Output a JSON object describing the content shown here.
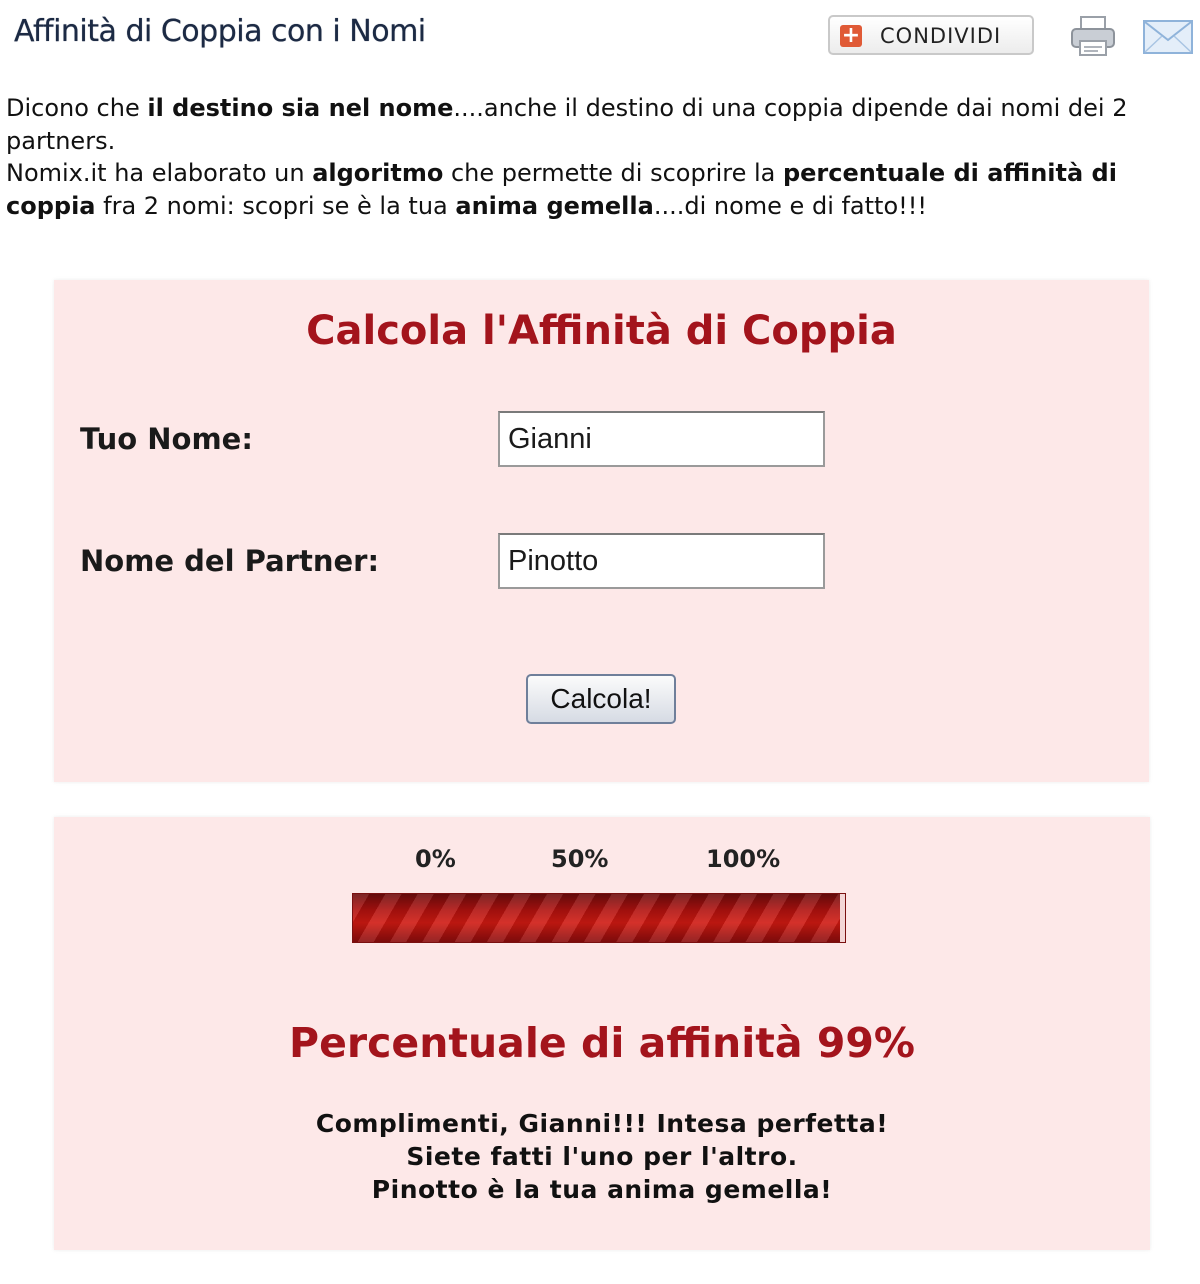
{
  "header": {
    "title": "Affinità di Coppia con i Nomi",
    "share_label": "CONDIVIDI",
    "share_icon": "plus-icon",
    "print_icon": "printer-icon",
    "mail_icon": "envelope-icon"
  },
  "intro": {
    "p1_a": "Dicono che ",
    "p1_b": "il destino sia nel nome",
    "p1_c": "....anche il destino di una coppia dipende dai nomi dei 2 partners.",
    "p2_a": "Nomix.it ha elaborato un ",
    "p2_b": "algoritmo",
    "p2_c": " che permette di scoprire la ",
    "p2_d": "percentuale di affinità di coppia",
    "p2_e": " fra 2 nomi: scopri se è la tua ",
    "p2_f": "anima gemella",
    "p2_g": "....di nome e di fatto!!!"
  },
  "form": {
    "title": "Calcola l'Affinità di Coppia",
    "your_name_label": "Tuo Nome:",
    "your_name_value": "Gianni",
    "partner_label": "Nome del Partner:",
    "partner_value": "Pinotto",
    "submit_label": "Calcola!"
  },
  "result": {
    "scale_0": "0%",
    "scale_50": "50%",
    "scale_100": "100%",
    "affinity_percent": 99,
    "title": "Percentuale di affinità 99%",
    "line_1": "Complimenti, Gianni!!! Intesa perfetta!",
    "line_2": "Siete fatti l'uno per l'altro.",
    "line_3": "Pinotto è la tua anima gemella!"
  },
  "colors": {
    "accent_red": "#a3141c",
    "panel_bg": "#fde8e8",
    "bar_red": "#b3120f"
  }
}
